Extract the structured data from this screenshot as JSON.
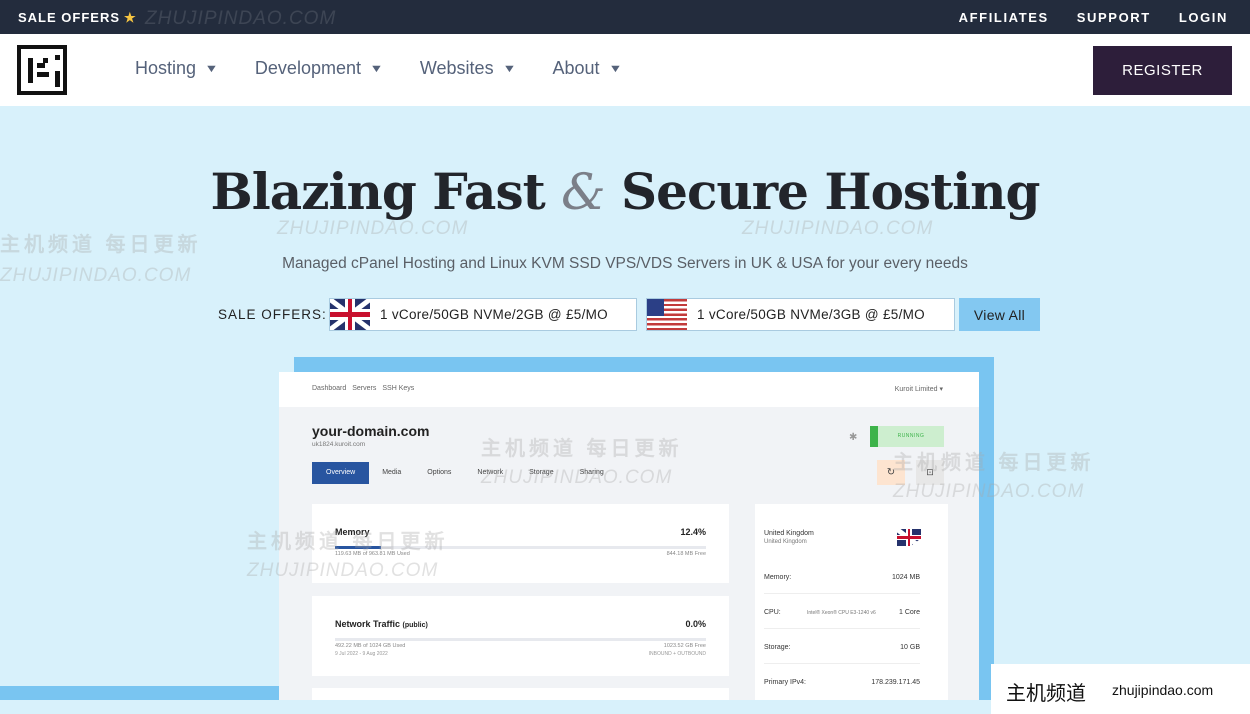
{
  "topbar": {
    "sale_offers": "SALE OFFERS",
    "links": [
      "AFFILIATES",
      "SUPPORT",
      "LOGIN"
    ]
  },
  "nav": {
    "items": [
      "Hosting",
      "Development",
      "Websites",
      "About"
    ],
    "register": "REGISTER"
  },
  "hero": {
    "title_part1": "Blazing Fast",
    "title_amp": "&",
    "title_part2": "Secure Hosting",
    "subtitle": "Managed cPanel Hosting and Linux KVM SSD VPS/VDS Servers in UK & USA for your every needs"
  },
  "offers": {
    "label": "SALE OFFERS:",
    "items": [
      {
        "flag": "uk-flag",
        "text": "1 vCore/50GB NVMe/2GB @ £5/MO"
      },
      {
        "flag": "us-flag",
        "text": "1 vCore/50GB NVMe/3GB @ £5/MO"
      }
    ],
    "view_all": "View All"
  },
  "mockup": {
    "crumbs": [
      "Dashboard",
      "Servers",
      "SSH Keys"
    ],
    "user": "Kuroit Limited ▾",
    "domain": "your-domain.com",
    "host": "uk1824.kuroit.com",
    "status": "RUNNING",
    "tabs": [
      "Overview",
      "Media",
      "Options",
      "Network",
      "Storage",
      "Sharing"
    ],
    "memory": {
      "title": "Memory",
      "percent": "12.4%",
      "percent_value": 12.4,
      "used": "119.63 MB of 963.81 MB Used",
      "free": "844.18 MB Free"
    },
    "network": {
      "title": "Network Traffic",
      "title_suffix": "(public)",
      "percent": "0.0%",
      "percent_value": 0,
      "used": "492.22 MB of 1024 GB Used",
      "free": "1023.52 GB Free",
      "date": "9 Jul 2022 - 9 Aug 2022",
      "io": "INBOUND + OUTBOUND"
    },
    "location": "United Kingdom",
    "location_sub": "United Kingdom",
    "specs": [
      {
        "label": "Memory:",
        "value": "1024 MB"
      },
      {
        "label": "CPU:",
        "detail": "Intel® Xeon® CPU E3-1240 v6",
        "value": "1 Core"
      },
      {
        "label": "Storage:",
        "value": "10 GB"
      },
      {
        "label": "Primary IPv4:",
        "value": "178.239.171.45"
      }
    ]
  },
  "watermark": {
    "cn": "主机频道 每日更新",
    "cn_short": "主机频道",
    "en": "ZHUJIPINDAO.COM",
    "domain": "zhujipindao.com"
  },
  "colors": {
    "topbar": "#232c3d",
    "hero_bg": "#d8f1fb",
    "register": "#2d1e3a",
    "view_all": "#83c8f1",
    "accent": "#2855a0"
  }
}
